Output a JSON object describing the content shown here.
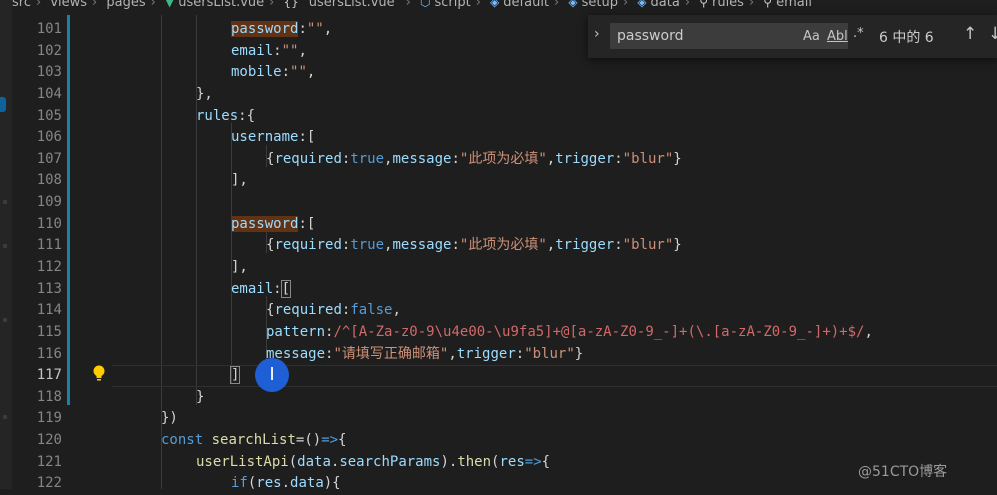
{
  "breadcrumb": {
    "items": [
      {
        "label": "src",
        "icon": ""
      },
      {
        "label": "views",
        "icon": ""
      },
      {
        "label": "pages",
        "icon": ""
      },
      {
        "label": "usersList.vue",
        "icon": "vue-icon"
      },
      {
        "label": "\"usersList.vue\"",
        "icon": "braces-icon"
      },
      {
        "label": "script",
        "icon": "cube-icon"
      },
      {
        "label": "default",
        "icon": "cube-icon"
      },
      {
        "label": "setup",
        "icon": "cube-icon"
      },
      {
        "label": "data",
        "icon": "cube-icon"
      },
      {
        "label": "rules",
        "icon": "wrench-icon"
      },
      {
        "label": "email",
        "icon": "wrench-icon"
      }
    ]
  },
  "find_widget": {
    "query": "password",
    "match_case_label": "Aa",
    "whole_word_label": "Abl",
    "regex_label": ".*",
    "match_count": "6 中的 6"
  },
  "editor": {
    "active_line": "117",
    "lines": [
      {
        "n": "101"
      },
      {
        "n": "102"
      },
      {
        "n": "103"
      },
      {
        "n": "104"
      },
      {
        "n": "105"
      },
      {
        "n": "106"
      },
      {
        "n": "107"
      },
      {
        "n": "108"
      },
      {
        "n": "109"
      },
      {
        "n": "110"
      },
      {
        "n": "111"
      },
      {
        "n": "112"
      },
      {
        "n": "113"
      },
      {
        "n": "114"
      },
      {
        "n": "115"
      },
      {
        "n": "116"
      },
      {
        "n": "117"
      },
      {
        "n": "118"
      },
      {
        "n": "119"
      },
      {
        "n": "120"
      },
      {
        "n": "121"
      },
      {
        "n": "122"
      }
    ],
    "tokens": {
      "password": "password",
      "email": "email",
      "mobile": "mobile",
      "rules": "rules",
      "username": "username",
      "required": "required",
      "message": "message",
      "trigger": "trigger",
      "pattern": "pattern",
      "true": "true",
      "false": "false",
      "required_msg": "\"此项为必填\"",
      "email_msg": "\"请填写正确邮箱\"",
      "blur": "\"blur\"",
      "empty_str": "\"\"",
      "regex": "/^[A-Za-z0-9\\u4e00-\\u9fa5]+@[a-zA-Z0-9_-]+(\\.[a-zA-Z0-9_-]+)+$/",
      "const": "const",
      "searchList": "searchList",
      "userListApi": "userListApi",
      "data": "data",
      "searchParams": "searchParams",
      "then": "then",
      "res": "res",
      "if": "if",
      "arrow": "=>"
    }
  },
  "watermark": "@51CTO博客",
  "colors": {
    "background": "#1e1e1e",
    "keyword": "#569cd6",
    "property": "#9cdcfe",
    "string": "#ce9178",
    "function": "#dcdcaa",
    "regex": "#d16969",
    "search_highlight": "#613214",
    "cursor_indicator": "#1f5fd6"
  }
}
